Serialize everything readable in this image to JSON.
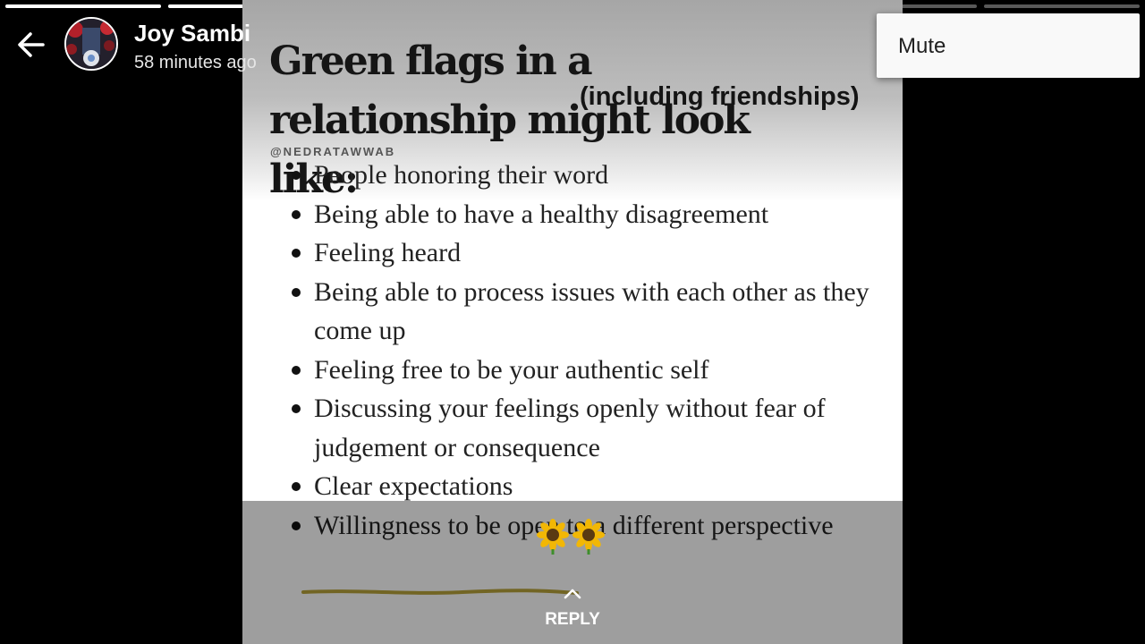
{
  "story": {
    "author": "Joy Sambi",
    "posted": "58 minutes ago",
    "progress": [
      1,
      1,
      1,
      1,
      1,
      0.4,
      0
    ],
    "accent": "#ffffff"
  },
  "menu": {
    "items": [
      "Mute"
    ]
  },
  "image": {
    "headline": "Green flags in a relationship might look like:",
    "subheading": "(including friendships)",
    "handle": "@NEDRATAWWAB",
    "flags": [
      "People honoring their word",
      "Being able to have a healthy disagreement",
      "Feeling heard",
      "Being able to process issues with each other as they come up",
      "Feeling free to be your authentic self",
      "Discussing your feelings openly without fear of judgement or consequence",
      "Clear expectations",
      "Willingness to be open to a different perspective"
    ],
    "sticker": "🌻🌻"
  },
  "reply": {
    "label": "REPLY",
    "icon": "chevron-up-icon"
  },
  "icons": {
    "back": "arrow-left-icon",
    "avatar": "profile-photo"
  }
}
